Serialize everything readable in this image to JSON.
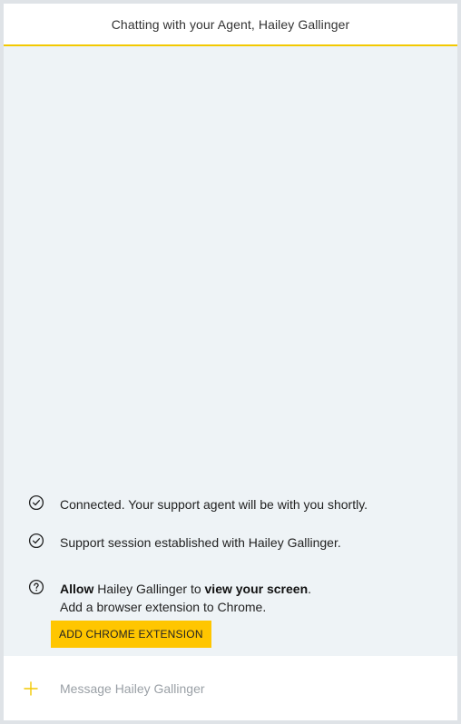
{
  "header": {
    "title": "Chatting with your Agent, Hailey Gallinger"
  },
  "messages": [
    {
      "icon": "check-circle-icon",
      "text": "Connected. Your support agent will be with you shortly."
    },
    {
      "icon": "check-circle-icon",
      "text": "Support session established with Hailey Gallinger."
    }
  ],
  "screen_share": {
    "icon": "question-circle-icon",
    "allow": "Allow",
    "agent_name": " Hailey Gallinger to ",
    "view_screen": "view your screen",
    "period": ".",
    "subtext": "Add a browser extension to Chrome.",
    "button_label": "ADD CHROME EXTENSION"
  },
  "composer": {
    "placeholder": "Message Hailey Gallinger",
    "value": "",
    "add_icon": "plus-icon"
  },
  "colors": {
    "accent": "#ffc600",
    "header_border": "#f3c900",
    "chat_background": "#eef3f6"
  }
}
